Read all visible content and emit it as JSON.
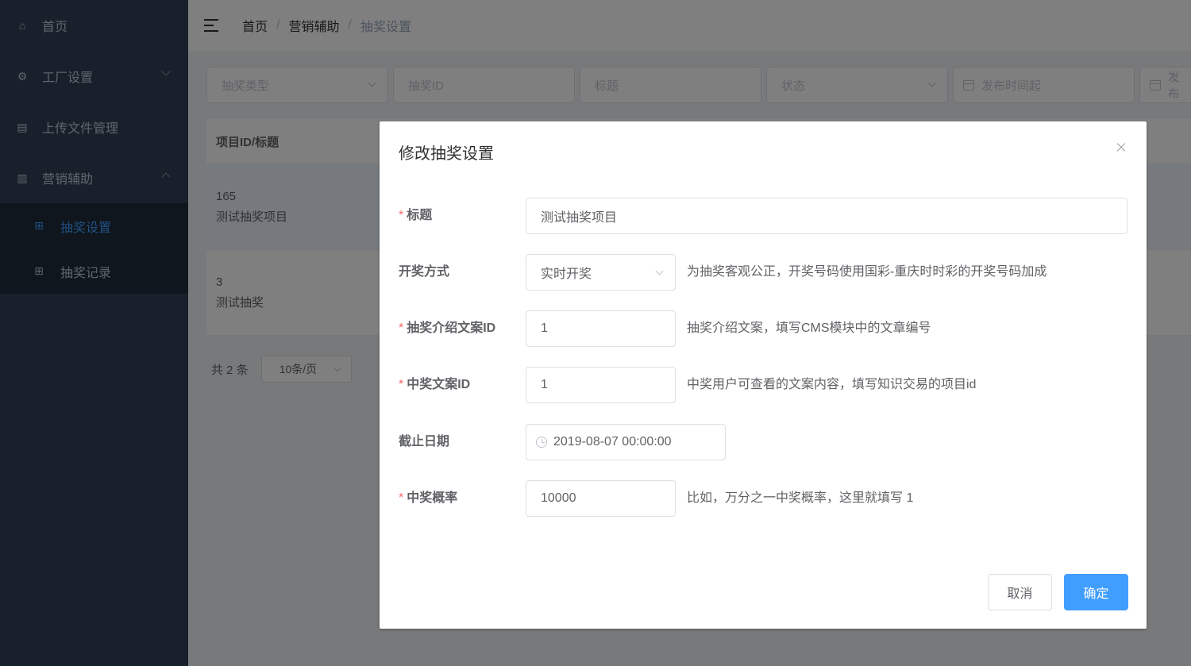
{
  "sidebar": {
    "items": [
      {
        "label": "首页",
        "icon": "home-icon"
      },
      {
        "label": "工厂设置",
        "icon": "gear-icon"
      },
      {
        "label": "上传文件管理",
        "icon": "document-icon"
      },
      {
        "label": "营销辅助",
        "icon": "chart-icon"
      }
    ],
    "subitems": [
      {
        "label": "抽奖设置",
        "icon": "gift-icon",
        "active": true
      },
      {
        "label": "抽奖记录",
        "icon": "gift-icon",
        "active": false
      }
    ]
  },
  "breadcrumb": {
    "items": [
      "首页",
      "营销辅助",
      "抽奖设置"
    ],
    "separator": "/"
  },
  "filters": {
    "lottery_type": "抽奖类型",
    "lottery_id": "抽奖ID",
    "title": "标题",
    "status": "状态",
    "publish_start": "发布时间起",
    "publish_end": "发布"
  },
  "table": {
    "header": "项目ID/标题",
    "rows": [
      {
        "id": "165",
        "title": "测试抽奖项目"
      },
      {
        "id": "3",
        "title": "测试抽奖"
      }
    ]
  },
  "pagination": {
    "total": "共 2 条",
    "page_size": "10条/页"
  },
  "dialog": {
    "title": "修改抽奖设置",
    "fields": {
      "title": {
        "label": "标题",
        "required": true,
        "value": "测试抽奖项目"
      },
      "draw_method": {
        "label": "开奖方式",
        "required": false,
        "value": "实时开奖",
        "hint": "为抽奖客观公正，开奖号码使用国彩-重庆时时彩的开奖号码加成"
      },
      "intro_doc_id": {
        "label": "抽奖介绍文案ID",
        "required": true,
        "value": "1",
        "hint": "抽奖介绍文案，填写CMS模块中的文章编号"
      },
      "win_doc_id": {
        "label": "中奖文案ID",
        "required": true,
        "value": "1",
        "hint": "中奖用户可查看的文案内容，填写知识交易的项目id"
      },
      "deadline": {
        "label": "截止日期",
        "required": false,
        "value": "2019-08-07 00:00:00"
      },
      "win_rate": {
        "label": "中奖概率",
        "required": true,
        "value": "10000",
        "hint": "比如，万分之一中奖概率，这里就填写 1"
      }
    },
    "cancel_label": "取消",
    "confirm_label": "确定"
  },
  "colors": {
    "sidebar_bg": "#304156",
    "submenu_bg": "#1f2d3d",
    "accent": "#409eff",
    "required": "#f56c6c"
  }
}
